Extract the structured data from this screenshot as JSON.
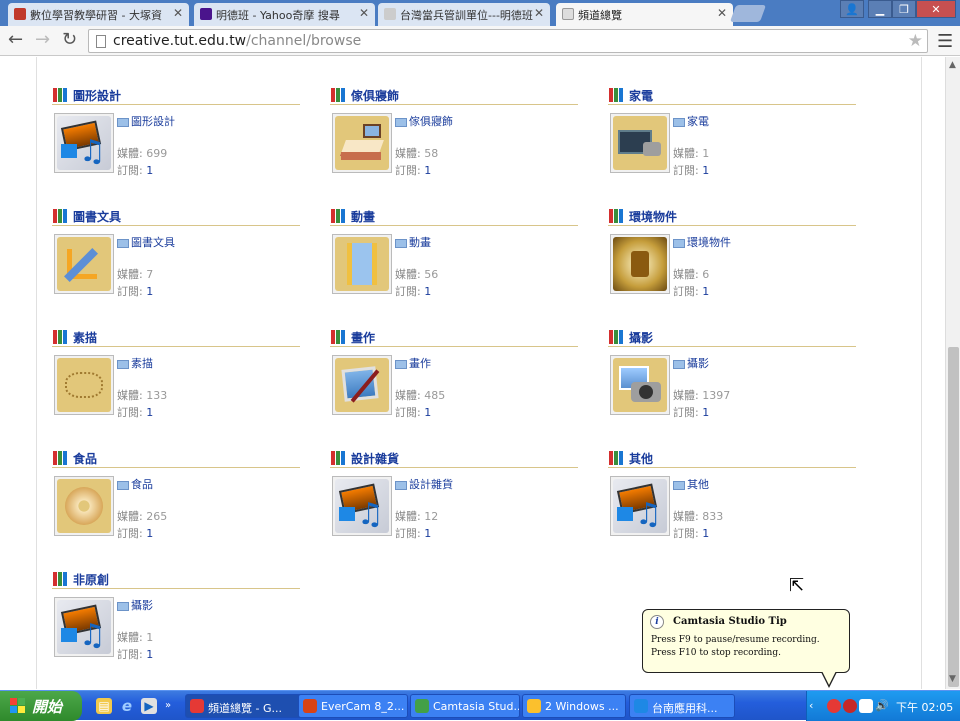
{
  "browser": {
    "tabs": [
      {
        "title": "數位學習教學研習 - 大塚資",
        "icon_color": "#c0392b"
      },
      {
        "title": "明德班 - Yahoo奇摩 搜尋",
        "icon_color": "#4a148c"
      },
      {
        "title": "台灣當兵管訓單位---明德班",
        "icon_color": "#cccccc"
      },
      {
        "title": "頻道總覽",
        "icon_color": "#dddddd"
      }
    ],
    "active_tab": 3,
    "url_host": "creative.tut.edu.tw",
    "url_path": "/channel/browse"
  },
  "page": {
    "media_label": "媒體: ",
    "sub_label": "訂閱: ",
    "channels": [
      {
        "title": "圖形設計",
        "sub": "圖形設計",
        "media": "699",
        "subscribe": "1",
        "thumb": "media-player"
      },
      {
        "title": "傢俱寢飾",
        "sub": "傢俱寢飾",
        "media": "58",
        "subscribe": "1",
        "thumb": "bedroom"
      },
      {
        "title": "家電",
        "sub": "家電",
        "media": "1",
        "subscribe": "1",
        "thumb": "appliance"
      },
      {
        "title": "圖書文具",
        "sub": "圖書文具",
        "media": "7",
        "subscribe": "1",
        "thumb": "stationery"
      },
      {
        "title": "動畫",
        "sub": "動畫",
        "media": "56",
        "subscribe": "1",
        "thumb": "film"
      },
      {
        "title": "環境物件",
        "sub": "環境物件",
        "media": "6",
        "subscribe": "1",
        "thumb": "environment"
      },
      {
        "title": "素描",
        "sub": "素描",
        "media": "133",
        "subscribe": "1",
        "thumb": "sketch"
      },
      {
        "title": "畫作",
        "sub": "畫作",
        "media": "485",
        "subscribe": "1",
        "thumb": "painting"
      },
      {
        "title": "攝影",
        "sub": "攝影",
        "media": "1397",
        "subscribe": "1",
        "thumb": "camera"
      },
      {
        "title": "食品",
        "sub": "食品",
        "media": "265",
        "subscribe": "1",
        "thumb": "donut"
      },
      {
        "title": "設計雜貨",
        "sub": "設計雜貨",
        "media": "12",
        "subscribe": "1",
        "thumb": "media-player"
      },
      {
        "title": "其他",
        "sub": "其他",
        "media": "833",
        "subscribe": "1",
        "thumb": "media-player"
      },
      {
        "title": "非原創",
        "sub": "攝影",
        "media": "1",
        "subscribe": "1",
        "thumb": "media-player"
      }
    ]
  },
  "tooltip": {
    "title": "Camtasia Studio Tip",
    "body": "Press F9 to pause/resume recording.  Press F10 to stop recording."
  },
  "taskbar": {
    "start_label": "開始",
    "tasks": [
      {
        "label": "頻道總覽 - G...",
        "icon_color": "#e53935",
        "active": true
      },
      {
        "label": "EverCam 8_2...",
        "icon_color": "#d84315",
        "active": false
      },
      {
        "label": "Camtasia Stud...",
        "icon_color": "#43a047",
        "active": false
      },
      {
        "label": "2 Windows ...",
        "icon_color": "#fbc02d",
        "active": false
      },
      {
        "label": "台南應用科...",
        "icon_color": "#1e88e5",
        "active": false
      }
    ],
    "clock": "下午 02:05"
  },
  "colors": {
    "accent": "#1a3c9c",
    "divider": "#d8c58a",
    "taskbar": "#245edc"
  }
}
